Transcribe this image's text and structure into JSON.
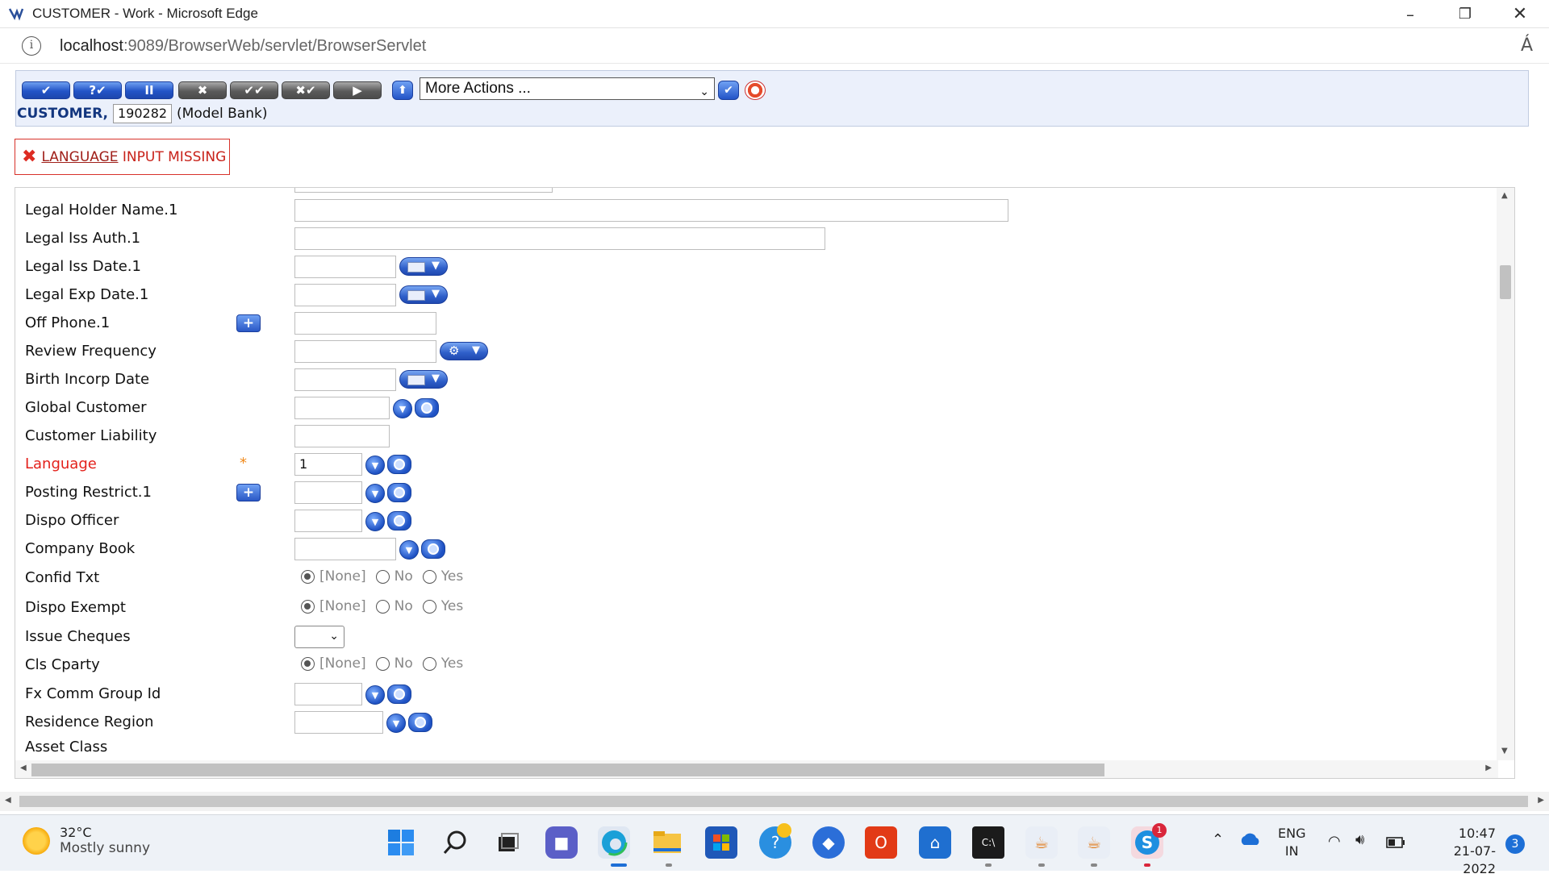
{
  "window": {
    "title": "CUSTOMER - Work - Microsoft Edge",
    "url_host": "localhost",
    "url_rest": ":9089/BrowserWeb/servlet/BrowserServlet",
    "minimize": "–",
    "restore": "❐",
    "close": "✕"
  },
  "toolbar": {
    "buttons": [
      {
        "name": "commit-button",
        "label": "✔",
        "style": "blue"
      },
      {
        "name": "validate-button",
        "label": "?✔",
        "style": "blue"
      },
      {
        "name": "hold-button",
        "label": "II",
        "style": "blue"
      },
      {
        "name": "delete-button",
        "label": "✖",
        "style": "gray"
      },
      {
        "name": "authorise-button",
        "label": "✔✔",
        "style": "gray"
      },
      {
        "name": "reverse-button",
        "label": "✖✔",
        "style": "gray"
      },
      {
        "name": "next-button",
        "label": "▶",
        "style": "gray"
      }
    ],
    "more_actions": "More Actions ...",
    "record_label": "CUSTOMER,",
    "record_id": "190282",
    "company": "(Model Bank)"
  },
  "error": {
    "field_link": "LANGUAGE",
    "message": " INPUT MISSING"
  },
  "form": {
    "fields": [
      {
        "label": "Legal Holder Name.1",
        "value": ""
      },
      {
        "label": "Legal Iss Auth.1",
        "value": ""
      },
      {
        "label": "Legal Iss Date.1",
        "value": ""
      },
      {
        "label": "Legal Exp Date.1",
        "value": ""
      },
      {
        "label": "Off Phone.1",
        "value": ""
      },
      {
        "label": "Review Frequency",
        "value": ""
      },
      {
        "label": "Birth Incorp Date",
        "value": ""
      },
      {
        "label": "Global Customer",
        "value": ""
      },
      {
        "label": "Customer Liability",
        "value": ""
      },
      {
        "label": "Language",
        "value": "1",
        "required_marker": "*"
      },
      {
        "label": "Posting Restrict.1",
        "value": ""
      },
      {
        "label": "Dispo Officer",
        "value": ""
      },
      {
        "label": "Company Book",
        "value": ""
      },
      {
        "label": "Confid Txt",
        "value": ""
      },
      {
        "label": "Dispo Exempt",
        "value": ""
      },
      {
        "label": "Issue Cheques",
        "value": ""
      },
      {
        "label": "Cls Cparty",
        "value": ""
      },
      {
        "label": "Fx Comm Group Id",
        "value": ""
      },
      {
        "label": "Residence Region",
        "value": ""
      },
      {
        "label": "Asset Class",
        "value": ""
      }
    ],
    "radio_options": [
      "[None]",
      "No",
      "Yes"
    ],
    "colors": {
      "required": "#e3211b",
      "accent": "#2354c7"
    }
  },
  "taskbar": {
    "weather_temp": "32°C",
    "weather_desc": "Mostly sunny",
    "lang_top": "ENG",
    "lang_bottom": "IN",
    "time": "10:47",
    "date": "21-07-2022",
    "notification_count": "3",
    "skype_badge": "1",
    "icons": [
      "windows-start-icon",
      "search-icon",
      "task-view-icon",
      "teams-chat-icon",
      "edge-icon",
      "file-explorer-icon",
      "microsoft-store-icon",
      "help-icon",
      "vpn-icon",
      "office-icon",
      "app-icon",
      "terminal-icon",
      "java-icon",
      "java-icon-2",
      "skype-icon"
    ]
  }
}
